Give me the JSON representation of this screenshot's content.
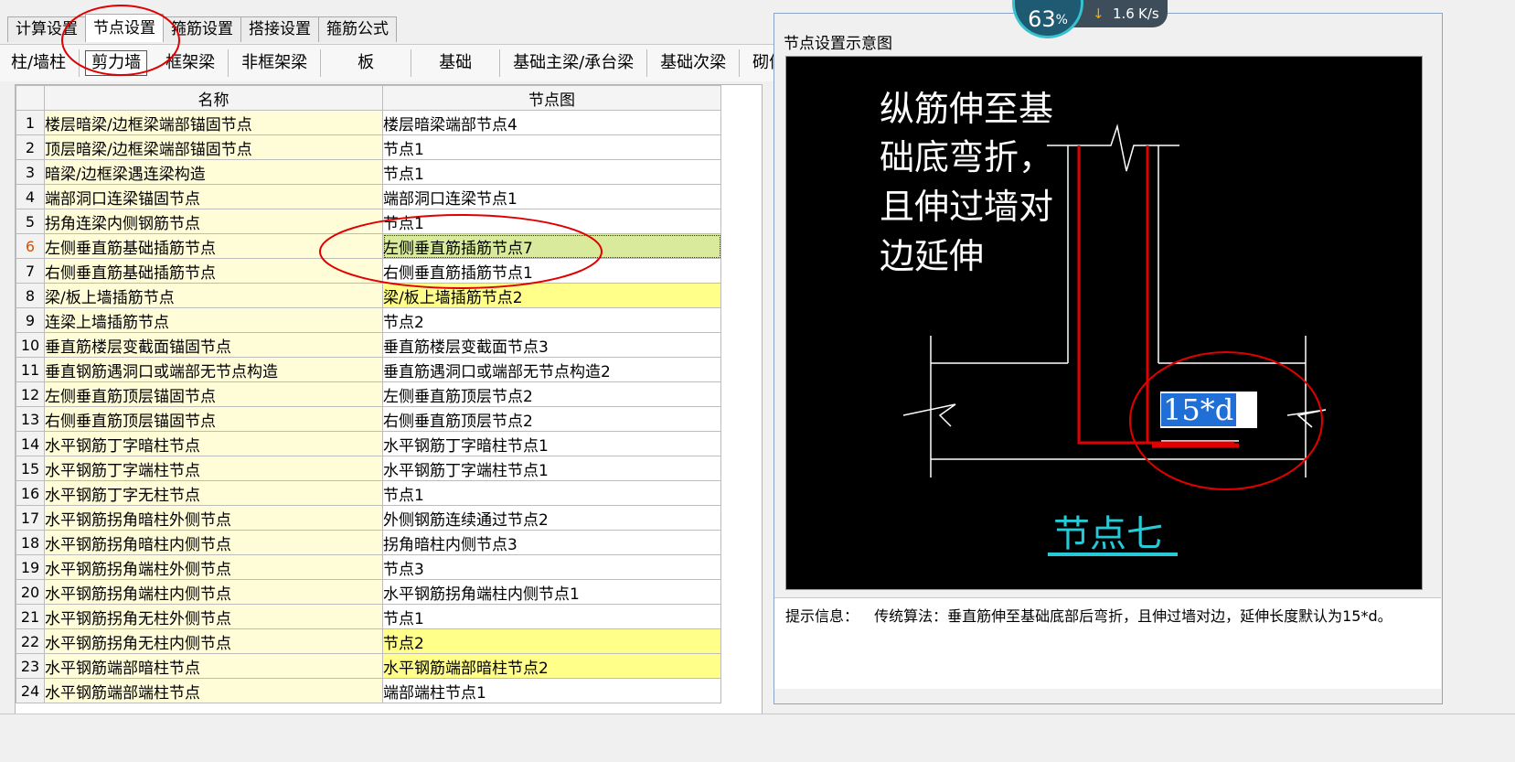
{
  "tabs": [
    "计算设置",
    "节点设置",
    "箍筋设置",
    "搭接设置",
    "箍筋公式"
  ],
  "subtabs": [
    "柱/墙柱",
    "剪力墙",
    "框架梁",
    "非框架梁",
    "板",
    "基础",
    "基础主梁/承台梁",
    "基础次梁",
    "砌体结"
  ],
  "table": {
    "headers": [
      "名称",
      "节点图"
    ],
    "rows": [
      {
        "num": "1",
        "name": "楼层暗梁/边框梁端部锚固节点",
        "value": "楼层暗梁端部节点4"
      },
      {
        "num": "2",
        "name": "顶层暗梁/边框梁端部锚固节点",
        "value": "节点1"
      },
      {
        "num": "3",
        "name": "暗梁/边框梁遇连梁构造",
        "value": "节点1"
      },
      {
        "num": "4",
        "name": "端部洞口连梁锚固节点",
        "value": "端部洞口连梁节点1"
      },
      {
        "num": "5",
        "name": "拐角连梁内侧钢筋节点",
        "value": "节点1"
      },
      {
        "num": "6",
        "name": "左侧垂直筋基础插筋节点",
        "value": "左侧垂直筋插筋节点7"
      },
      {
        "num": "7",
        "name": "右侧垂直筋基础插筋节点",
        "value": "右侧垂直筋插筋节点1"
      },
      {
        "num": "8",
        "name": "梁/板上墙插筋节点",
        "value": "梁/板上墙插筋节点2"
      },
      {
        "num": "9",
        "name": "连梁上墙插筋节点",
        "value": "节点2"
      },
      {
        "num": "10",
        "name": "垂直筋楼层变截面锚固节点",
        "value": "垂直筋楼层变截面节点3"
      },
      {
        "num": "11",
        "name": "垂直钢筋遇洞口或端部无节点构造",
        "value": "垂直筋遇洞口或端部无节点构造2"
      },
      {
        "num": "12",
        "name": "左侧垂直筋顶层锚固节点",
        "value": "左侧垂直筋顶层节点2"
      },
      {
        "num": "13",
        "name": "右侧垂直筋顶层锚固节点",
        "value": "右侧垂直筋顶层节点2"
      },
      {
        "num": "14",
        "name": "水平钢筋丁字暗柱节点",
        "value": "水平钢筋丁字暗柱节点1"
      },
      {
        "num": "15",
        "name": "水平钢筋丁字端柱节点",
        "value": "水平钢筋丁字端柱节点1"
      },
      {
        "num": "16",
        "name": "水平钢筋丁字无柱节点",
        "value": "节点1"
      },
      {
        "num": "17",
        "name": "水平钢筋拐角暗柱外侧节点",
        "value": "外侧钢筋连续通过节点2"
      },
      {
        "num": "18",
        "name": "水平钢筋拐角暗柱内侧节点",
        "value": "拐角暗柱内侧节点3"
      },
      {
        "num": "19",
        "name": "水平钢筋拐角端柱外侧节点",
        "value": "节点3"
      },
      {
        "num": "20",
        "name": "水平钢筋拐角端柱内侧节点",
        "value": "水平钢筋拐角端柱内侧节点1"
      },
      {
        "num": "21",
        "name": "水平钢筋拐角无柱外侧节点",
        "value": "节点1"
      },
      {
        "num": "22",
        "name": "水平钢筋拐角无柱内侧节点",
        "value": "节点2"
      },
      {
        "num": "23",
        "name": "水平钢筋端部暗柱节点",
        "value": "水平钢筋端部暗柱节点2"
      },
      {
        "num": "24",
        "name": "水平钢筋端部端柱节点",
        "value": "端部端柱节点1"
      }
    ]
  },
  "panel": {
    "title": "节点设置示意图",
    "diagram_text": [
      "纵筋伸至基",
      "础底弯折，",
      "且伸过墙对",
      "边延伸"
    ],
    "dim_label": "15*d",
    "node_name": "节点七",
    "hint_label": "提示信息：",
    "hint_text": "传统算法：垂直筋伸至基础底部后弯折，且伸过墙对边，延伸长度默认为15*d。"
  },
  "widget": {
    "percent": "63",
    "percent_unit": "%",
    "speed": "1.6",
    "speed_unit": "K/s"
  },
  "colors": {
    "rebar": "#e00000",
    "node_title": "#27c9d6",
    "dim_highlight": "#1f6fd6",
    "annotation": "#e00000"
  }
}
